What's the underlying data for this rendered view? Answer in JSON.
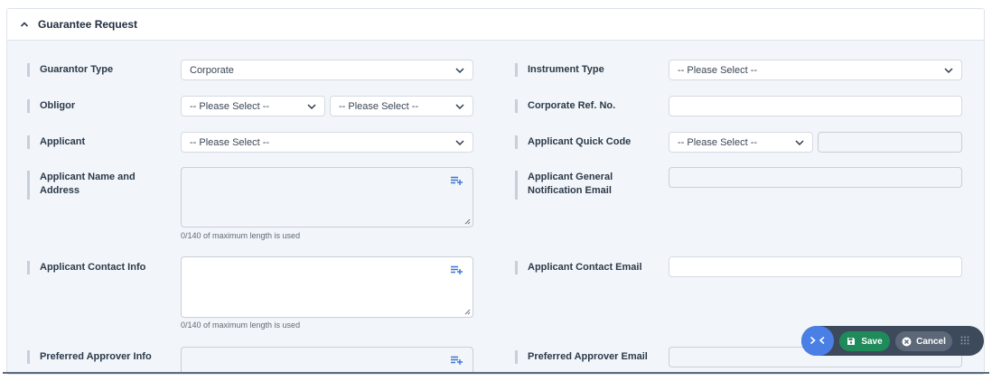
{
  "panel": {
    "title": "Guarantee Request"
  },
  "left": {
    "guarantor_type": {
      "label": "Guarantor Type",
      "value": "Corporate"
    },
    "obligor": {
      "label": "Obligor",
      "value1": "-- Please Select --",
      "value2": "-- Please Select --"
    },
    "applicant": {
      "label": "Applicant",
      "value": "-- Please Select --"
    },
    "applicant_name_address": {
      "label": "Applicant Name and Address",
      "hint": "0/140 of maximum length is used"
    },
    "applicant_contact_info": {
      "label": "Applicant Contact Info",
      "hint": "0/140 of maximum length is used"
    },
    "preferred_approver_info": {
      "label": "Preferred Approver Info"
    }
  },
  "right": {
    "instrument_type": {
      "label": "Instrument Type",
      "value": "-- Please Select --"
    },
    "corporate_ref_no": {
      "label": "Corporate Ref. No.",
      "value": ""
    },
    "applicant_quick_code": {
      "label": "Applicant Quick Code",
      "value": "-- Please Select --",
      "extra_value": ""
    },
    "applicant_general_notification_email": {
      "label": "Applicant General Notification Email",
      "value": ""
    },
    "applicant_contact_email": {
      "label": "Applicant Contact Email",
      "value": ""
    },
    "preferred_approver_email": {
      "label": "Preferred Approver Email",
      "value": ""
    }
  },
  "actions": {
    "save_label": "Save",
    "cancel_label": "Cancel"
  },
  "colors": {
    "save": "#1f8a5a",
    "cancel": "#5c6878",
    "toggle": "#4a7fe5",
    "bar": "#3c4a5c"
  }
}
